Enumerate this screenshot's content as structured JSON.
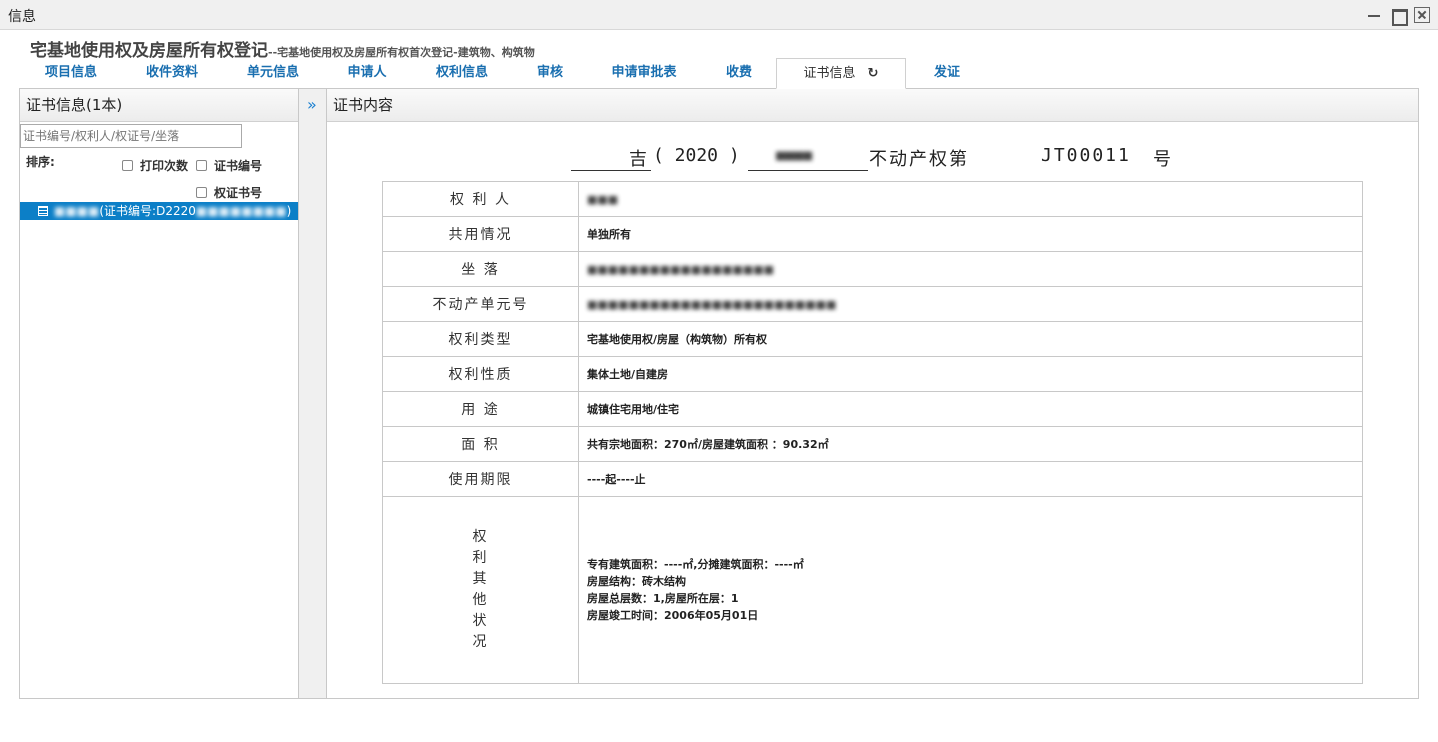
{
  "window": {
    "title": "信息"
  },
  "heading": {
    "main": "宅基地使用权及房屋所有权登记",
    "sub": "--宅基地使用权及房屋所有权首次登记-建筑物、构筑物"
  },
  "tabs": [
    "项目信息",
    "收件资料",
    "单元信息",
    "申请人",
    "权利信息",
    "审核",
    "申请审批表",
    "收费",
    "证书信息",
    "发证"
  ],
  "active_tab": "证书信息",
  "left_panel": {
    "header": "证书信息(1本)",
    "search_placeholder": "证书编号/权利人/权证号/坐落",
    "sort_label": "排序:",
    "sort_options": [
      "打印次数",
      "证书编号",
      "权证书号"
    ],
    "tree_item": {
      "prefix": "(证书编号:D2220",
      "suffix": ")"
    }
  },
  "right_panel": {
    "header": "证书内容",
    "cert_line": {
      "province": "吉",
      "year": "( 2020 )",
      "text": "不动产权第",
      "number": "JT00011",
      "end": "号"
    },
    "rows": [
      {
        "label": "权 利 人",
        "value": ""
      },
      {
        "label": "共用情况",
        "value": "单独所有"
      },
      {
        "label": "坐  落",
        "value": ""
      },
      {
        "label": "不动产单元号",
        "value": ""
      },
      {
        "label": "权利类型",
        "value": "宅基地使用权/房屋（构筑物）所有权"
      },
      {
        "label": "权利性质",
        "value": "集体土地/自建房"
      },
      {
        "label": "用  途",
        "value": "城镇住宅用地/住宅"
      },
      {
        "label": "面  积",
        "value": "共有宗地面积：270㎡/房屋建筑面积 ：90.32㎡"
      },
      {
        "label": "使用期限",
        "value": "----起----止"
      }
    ],
    "other_label": "权利其他状况",
    "other_lines": [
      "专有建筑面积：----㎡,分摊建筑面积：----㎡",
      "房屋结构：砖木结构",
      "房屋总层数：1,房屋所在层：1",
      "房屋竣工时间：2006年05月01日"
    ]
  }
}
